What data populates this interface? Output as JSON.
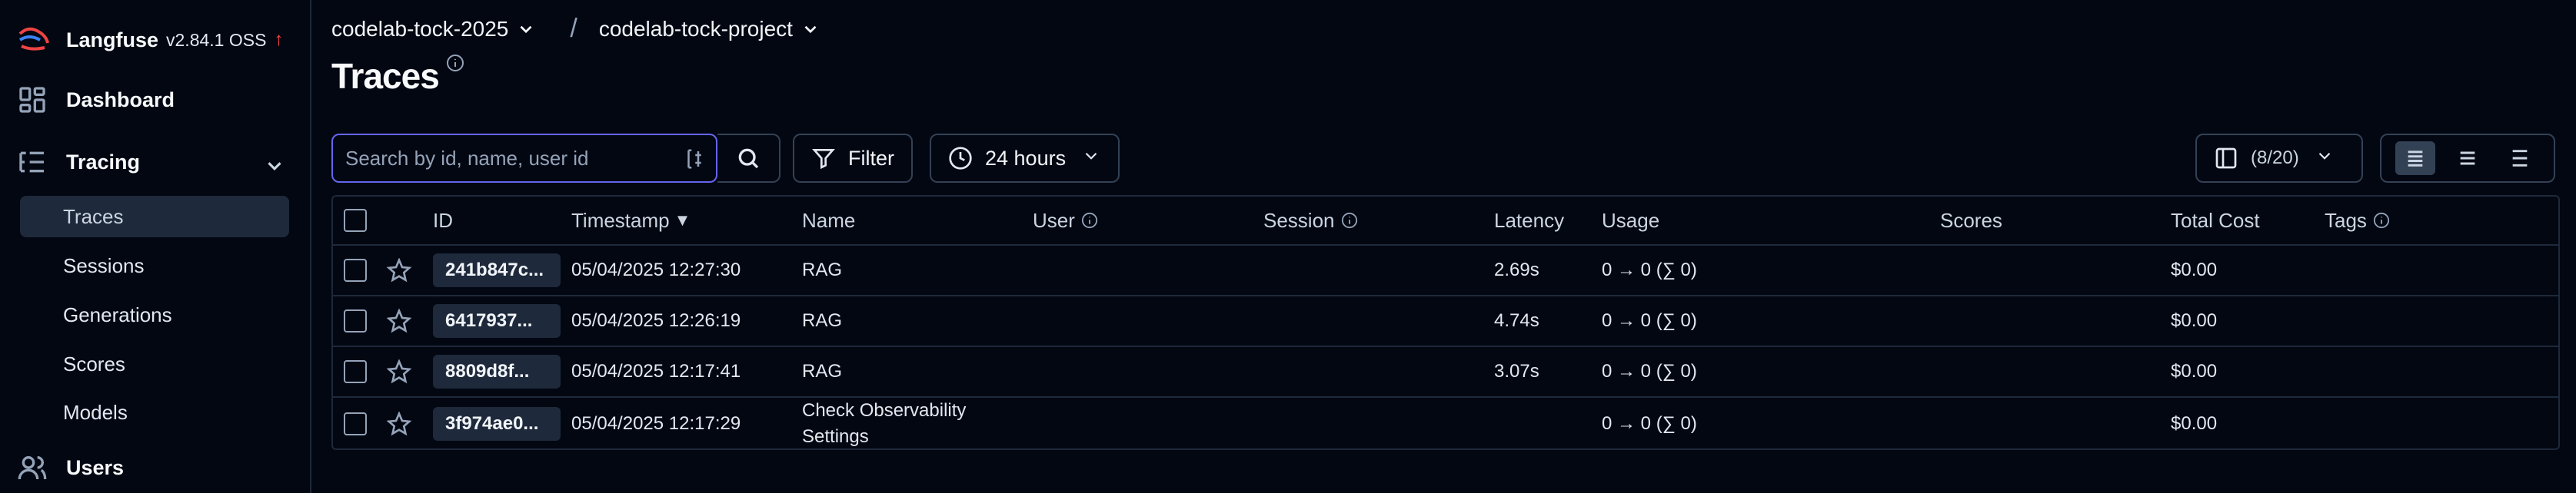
{
  "brand": {
    "name": "Langfuse",
    "version": "v2.84.1 OSS",
    "update_icon": "arrow-up-icon",
    "update_color": "#ef4444"
  },
  "sidebar": {
    "items": [
      {
        "label": "Dashboard",
        "icon": "dashboard-icon"
      },
      {
        "label": "Tracing",
        "icon": "tracing-icon",
        "expanded": true
      },
      {
        "label": "Users",
        "icon": "users-icon"
      }
    ],
    "tracing_children": [
      {
        "label": "Traces",
        "active": true
      },
      {
        "label": "Sessions"
      },
      {
        "label": "Generations"
      },
      {
        "label": "Scores"
      },
      {
        "label": "Models"
      }
    ]
  },
  "breadcrumb": {
    "org": "codelab-tock-2025",
    "separator": "/",
    "project": "codelab-tock-project"
  },
  "page": {
    "title": "Traces"
  },
  "toolbar": {
    "search_placeholder": "Search by id, name, user id",
    "filter_label": "Filter",
    "time_range": "24 hours",
    "columns_label": "(8/20)"
  },
  "table": {
    "headers": {
      "id": "ID",
      "timestamp": "Timestamp",
      "name": "Name",
      "user": "User",
      "session": "Session",
      "latency": "Latency",
      "usage": "Usage",
      "scores": "Scores",
      "total_cost": "Total Cost",
      "tags": "Tags"
    },
    "rows": [
      {
        "id": "241b847c...",
        "timestamp": "05/04/2025 12:27:30",
        "name": "RAG",
        "latency": "2.69s",
        "usage": "0 → 0 (∑ 0)",
        "cost": "$0.00"
      },
      {
        "id": "6417937...",
        "timestamp": "05/04/2025 12:26:19",
        "name": "RAG",
        "latency": "4.74s",
        "usage": "0 → 0 (∑ 0)",
        "cost": "$0.00"
      },
      {
        "id": "8809d8f...",
        "timestamp": "05/04/2025 12:17:41",
        "name": "RAG",
        "latency": "3.07s",
        "usage": "0 → 0 (∑ 0)",
        "cost": "$0.00"
      },
      {
        "id": "3f974ae0...",
        "timestamp": "05/04/2025 12:17:29",
        "name": "Check Observability Settings",
        "latency": "",
        "usage": "0 → 0 (∑ 0)",
        "cost": "$0.00"
      }
    ]
  },
  "colors": {
    "background": "#030712",
    "accent": "#6366f1",
    "border": "#1e293b"
  }
}
